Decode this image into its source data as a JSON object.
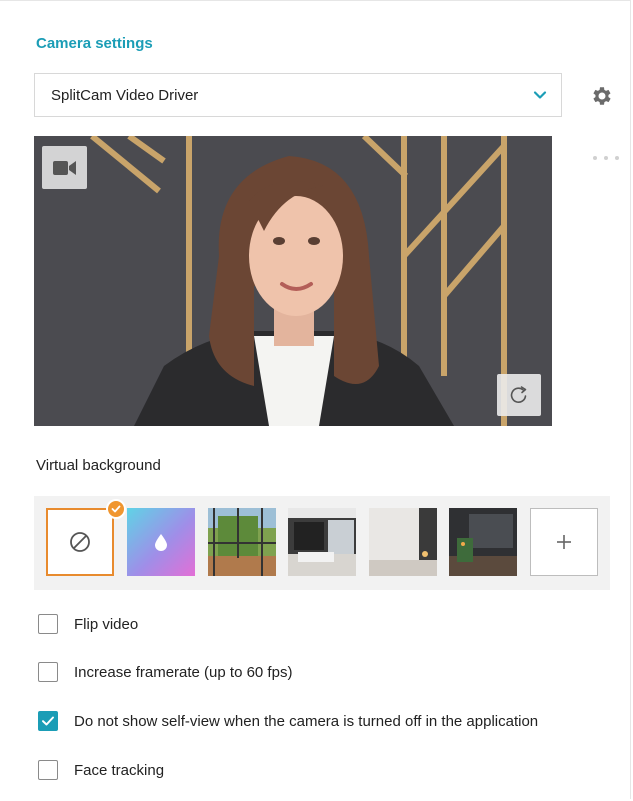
{
  "camera": {
    "section_title": "Camera settings",
    "device_selected": "SplitCam Video Driver",
    "settings_icon": "gear-icon",
    "camera_toggle_icon": "video-camera-icon",
    "rotate_icon": "rotate-icon"
  },
  "virtual_background": {
    "label": "Virtual background",
    "selected": "none",
    "items": [
      {
        "kind": "none",
        "icon": "no-background-icon"
      },
      {
        "kind": "blur",
        "icon": "blur-drop-icon"
      },
      {
        "kind": "image",
        "name": "balcony"
      },
      {
        "kind": "image",
        "name": "modern-living-room"
      },
      {
        "kind": "image",
        "name": "bright-room"
      },
      {
        "kind": "image",
        "name": "dark-living-room"
      },
      {
        "kind": "add",
        "icon": "plus-icon"
      }
    ]
  },
  "options": [
    {
      "label": "Flip video",
      "checked": false
    },
    {
      "label": "Increase framerate (up to 60 fps)",
      "checked": false
    },
    {
      "label": "Do not show self-view when the camera is turned off in the application",
      "checked": true
    },
    {
      "label": "Face tracking",
      "checked": false
    }
  ],
  "colors": {
    "accent": "#1b9db6",
    "selected_border": "#e88b2e",
    "badge": "#f0962f"
  }
}
